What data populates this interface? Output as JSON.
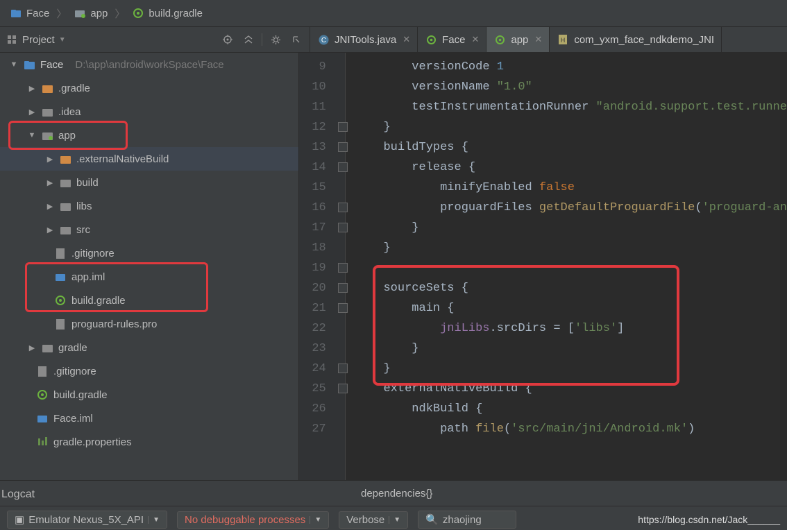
{
  "breadcrumb": {
    "b1": "Face",
    "b2": "app",
    "b3": "build.gradle"
  },
  "project": {
    "title": "Project",
    "root_name": "Face",
    "root_path": "D:\\app\\android\\workSpace\\Face"
  },
  "tree": {
    "n_gradle": ".gradle",
    "n_idea": ".idea",
    "n_app": "app",
    "n_ext": ".externalNativeBuild",
    "n_build": "build",
    "n_libs": "libs",
    "n_src": "src",
    "n_gitig": ".gitignore",
    "n_appiml": "app.iml",
    "n_bgradle": "build.gradle",
    "n_prog": "proguard-rules.pro",
    "n_gradle2": "gradle",
    "n_gitig2": ".gitignore",
    "n_bgradle2": "build.gradle",
    "n_faceiml": "Face.iml",
    "n_gprops": "gradle.properties"
  },
  "tabs": {
    "t1": "JNITools.java",
    "t2": "Face",
    "t3": "app",
    "t4": "com_yxm_face_ndkdemo_JNI"
  },
  "code": {
    "l9a": "versionCode ",
    "l9b": "1",
    "l10a": "versionName ",
    "l10b": "\"1.0\"",
    "l11a": "testInstrumentationRunner ",
    "l11b": "\"android.support.test.runne",
    "l12": "}",
    "l13": "buildTypes {",
    "l14": "release {",
    "l15a": "minifyEnabled ",
    "l15b": "false",
    "l16a": "proguardFiles ",
    "l16b": "getDefaultProguardFile",
    "l16c": "(",
    "l16d": "'proguard-an",
    "l17": "}",
    "l18": "}",
    "l19": "",
    "l20": "sourceSets {",
    "l21": "main {",
    "l22a": "jniLibs",
    "l22b": ".srcDirs = [",
    "l22c": "'libs'",
    "l22d": "]",
    "l23": "}",
    "l24": "}",
    "l25": "externalNativeBuild {",
    "l26": "ndkBuild {",
    "l27a": "path ",
    "l27b": "file",
    "l27c": "(",
    "l27d": "'src/main/jni/Android.mk'",
    "l27e": ")"
  },
  "bc2": "dependencies{}",
  "logcat_label": "Logcat",
  "bottom": {
    "emu": "Emulator Nexus_5X_API",
    "nodbg": "No debuggable processes",
    "verbose": "Verbose",
    "search": "zhaojing"
  },
  "watermark": "https://blog.csdn.net/Jack______"
}
